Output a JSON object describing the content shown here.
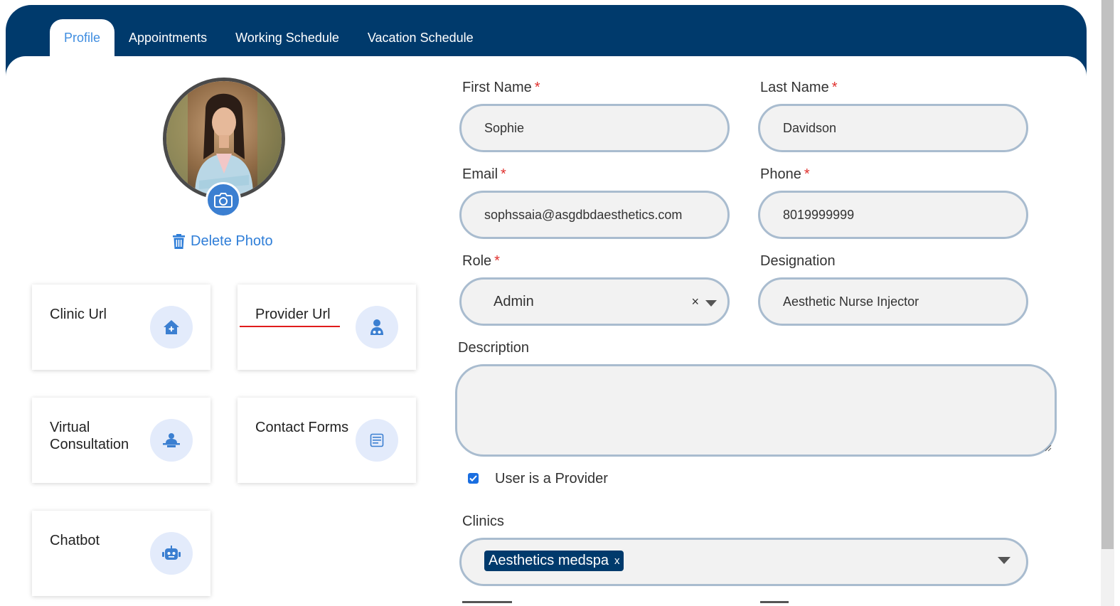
{
  "tabs": [
    {
      "label": "Profile"
    },
    {
      "label": "Appointments"
    },
    {
      "label": "Working Schedule"
    },
    {
      "label": "Vacation Schedule"
    }
  ],
  "profile": {
    "delete_photo_label": "Delete Photo"
  },
  "tiles": {
    "clinic_url": "Clinic Url",
    "provider_url": "Provider Url",
    "virtual_consultation": "Virtual Consultation",
    "contact_forms": "Contact Forms",
    "chatbot": "Chatbot"
  },
  "form": {
    "first_name": {
      "label": "First Name",
      "value": "Sophie",
      "required": "*"
    },
    "last_name": {
      "label": "Last Name",
      "value": "Davidson",
      "required": "*"
    },
    "email": {
      "label": "Email",
      "value": "sophssaia@asgdbdaesthetics.com",
      "required": "*"
    },
    "phone": {
      "label": "Phone",
      "value": "8019999999",
      "required": "*"
    },
    "role": {
      "label": "Role",
      "value": "Admin",
      "required": "*",
      "clear": "×"
    },
    "designation": {
      "label": "Designation",
      "value": "Aesthetic Nurse Injector"
    },
    "description": {
      "label": "Description",
      "value": ""
    },
    "is_provider": {
      "label": "User is a Provider",
      "checked": true
    },
    "clinics": {
      "label": "Clinics",
      "selected": [
        {
          "label": "Aesthetics medspa",
          "remove": "x"
        }
      ]
    }
  },
  "colors": {
    "header": "#003a6c",
    "accent": "#3f8de0",
    "field_border": "#a9bccf",
    "required": "#e0302d"
  }
}
